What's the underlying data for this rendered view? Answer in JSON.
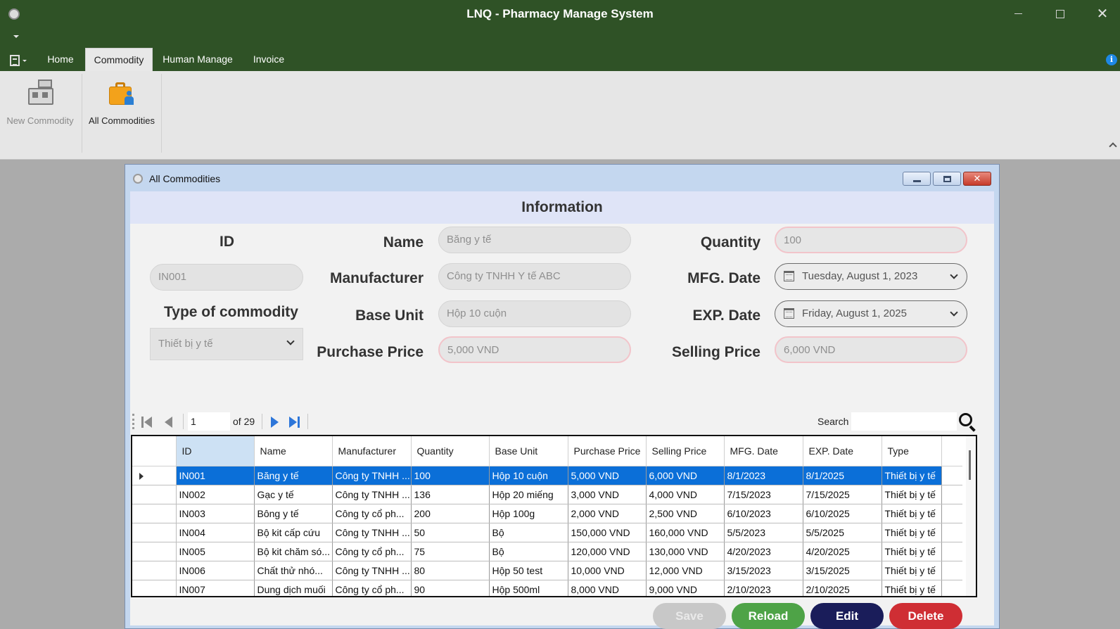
{
  "window": {
    "title": "LNQ - Pharmacy Manage System"
  },
  "ribbon": {
    "tabs": [
      {
        "label": "Home"
      },
      {
        "label": "Commodity"
      },
      {
        "label": "Human Manage"
      },
      {
        "label": "Invoice"
      }
    ],
    "active_tab": "Commodity",
    "buttons": {
      "new_commodity": "New Commodity",
      "all_commodities": "All Commodities"
    }
  },
  "child_window": {
    "title": "All Commodities"
  },
  "form": {
    "header": "Information",
    "labels": {
      "id": "ID",
      "type": "Type of commodity",
      "name": "Name",
      "manufacturer": "Manufacturer",
      "base_unit": "Base Unit",
      "purchase_price": "Purchase Price",
      "quantity": "Quantity",
      "mfg_date": "MFG. Date",
      "exp_date": "EXP. Date",
      "selling_price": "Selling Price"
    },
    "values": {
      "id": "IN001",
      "type": "Thiết bị y tế",
      "name": "Băng y tế",
      "manufacturer": "Công ty TNHH Y tế ABC",
      "base_unit": "Hộp 10 cuộn",
      "purchase_price": "5,000 VND",
      "quantity": "100",
      "mfg_date": "Tuesday, August 1, 2023",
      "exp_date": "Friday, August 1, 2025",
      "selling_price": "6,000 VND"
    }
  },
  "navigator": {
    "position": "1",
    "total": "of 29",
    "search_label": "Search",
    "search_value": ""
  },
  "grid": {
    "columns": [
      "ID",
      "Name",
      "Manufacturer",
      "Quantity",
      "Base Unit",
      "Purchase Price",
      "Selling Price",
      "MFG. Date",
      "EXP.  Date",
      "Type"
    ],
    "rows": [
      [
        "IN001",
        "Băng y tế",
        "Công ty TNHH ...",
        "100",
        "Hộp 10 cuộn",
        "5,000 VND",
        "6,000 VND",
        "8/1/2023",
        "8/1/2025",
        "Thiết bị y tế"
      ],
      [
        "IN002",
        "Gạc y tế",
        "Công ty TNHH ...",
        "136",
        "Hộp 20 miếng",
        "3,000 VND",
        "4,000 VND",
        "7/15/2023",
        "7/15/2025",
        "Thiết bị y tế"
      ],
      [
        "IN003",
        "Bông y tế",
        "Công ty cổ ph...",
        "200",
        "Hộp 100g",
        "2,000 VND",
        "2,500 VND",
        "6/10/2023",
        "6/10/2025",
        "Thiết bị y tế"
      ],
      [
        "IN004",
        "Bộ kit cấp cứu",
        "Công ty TNHH ...",
        "50",
        "Bộ",
        "150,000 VND",
        "160,000 VND",
        "5/5/2023",
        "5/5/2025",
        "Thiết bị y tế"
      ],
      [
        "IN005",
        "Bộ kit chăm só...",
        "Công ty cổ ph...",
        "75",
        "Bộ",
        "120,000 VND",
        "130,000 VND",
        "4/20/2023",
        "4/20/2025",
        "Thiết bị y tế"
      ],
      [
        "IN006",
        "Chất thử nhó...",
        "Công ty TNHH ...",
        "80",
        "Hộp 50 test",
        "10,000 VND",
        "12,000 VND",
        "3/15/2023",
        "3/15/2025",
        "Thiết bị y tế"
      ],
      [
        "IN007",
        "Dung dịch muối",
        "Công ty cổ ph...",
        "90",
        "Hộp 500ml",
        "8,000 VND",
        "9,000 VND",
        "2/10/2023",
        "2/10/2025",
        "Thiết bị y tế"
      ]
    ],
    "selected_row": 0
  },
  "actions": {
    "save": "Save",
    "reload": "Reload",
    "edit": "Edit",
    "delete": "Delete"
  },
  "colors": {
    "titlebar": "#2f5226",
    "selection": "#0b6fd8",
    "reload": "#4ea347",
    "edit": "#1a1d5a",
    "delete": "#cf2e34"
  }
}
